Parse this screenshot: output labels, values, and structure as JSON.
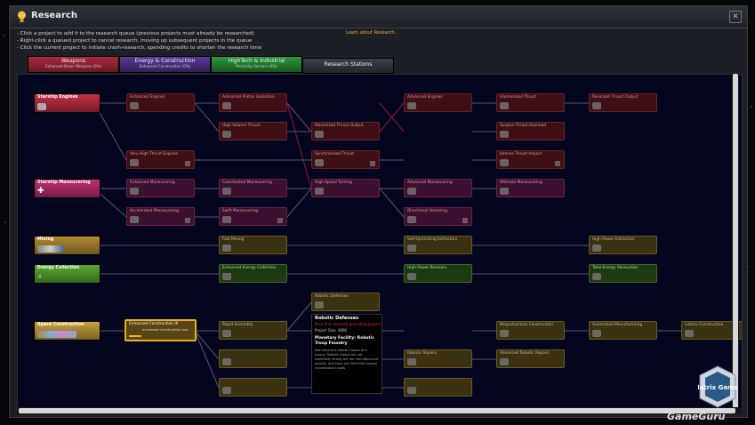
{
  "window": {
    "title": "Research",
    "close_glyph": "✕"
  },
  "instructions": [
    "- Click a project to add it to the research queue (previous projects must already be researched)",
    "- Right-click a queued project to cancel research, moving up subsequent projects in the queue",
    "- Click the current project to initiate crash-research, spending credits to shorten the research time"
  ],
  "learn_link": "Learn about Research...",
  "tabs": [
    {
      "label": "Weapons",
      "sub": "Enhanced Beam Weapons (0%)",
      "color": "#7a1c2a"
    },
    {
      "label": "Energy & Construction",
      "sub": "Enhanced Construction (0%)",
      "color": "#4a2a78"
    },
    {
      "label": "HighTech & Industrial",
      "sub": "Proximity Sensors (4%)",
      "color": "#1c6a2a"
    },
    {
      "label": "Research Stations",
      "sub": "",
      "color": "#2a2e38"
    }
  ],
  "categories": [
    {
      "label": "Starship Engines",
      "color": "red"
    },
    {
      "label": "Starship Maneuvering",
      "color": "pink"
    },
    {
      "label": "Mining",
      "color": "yel"
    },
    {
      "label": "Energy Collection",
      "color": "grn"
    },
    {
      "label": "Space Construction",
      "color": "gold"
    }
  ],
  "nodes": {
    "n1": "Enhanced Engines",
    "n2": "Advanced Proton Ionization",
    "n3": "Advanced Engines",
    "n4": "Harmonized Thrust",
    "n5": "Resonant Thrust Output",
    "n6": "High Volume Thrust",
    "n7": "Maximized Thrust Output",
    "n8": "Surplus Thrust Overload",
    "n9": "Very High Thrust Engines",
    "n10": "Synchronized Thrust",
    "n11": "Intense Thrust Impact",
    "n12": "Enhanced Maneuvering",
    "n13": "Coordinated Maneuvering",
    "n14": "High Speed Turning",
    "n15": "Advanced Maneuvering",
    "n16": "Ultimate Maneuvering",
    "n17": "Accelerated Maneuvering",
    "n18": "Swift Maneuvering",
    "n19": "Directional Vectoring",
    "n20": "Fast Mining",
    "n21": "Self-Optimizing Extractors",
    "n22": "High Power Extractors",
    "n23": "Enhanced Energy Collection",
    "n24": "High Power Reactors",
    "n25": "Total Energy Absorption",
    "n26": "Robotic Defenses",
    "n27": "Enhanced Construction III",
    "n27_sub": "Increased construction size",
    "n28": "Rapid Assembly",
    "n29": "Megastructure Construction",
    "n30": "Automated Manufacturing",
    "n31": "Lattice Construction",
    "n32": "Robotic Repairs",
    "n33": "Advanced Robotic Repairs"
  },
  "tooltip": {
    "title": "Robotic Defenses",
    "warning": "Must first research preceding project",
    "size": "Project Size: 480K",
    "feature": "Planetary Facility: Robotic Troop Foundry",
    "desc": "Manufactures robotic troops at a colony. Robotic troops are not especially strong but are manufactured quickly, and have one third the normal maintenance costs"
  },
  "logo_text": "Matrix Games",
  "watermark": "GameGuru"
}
